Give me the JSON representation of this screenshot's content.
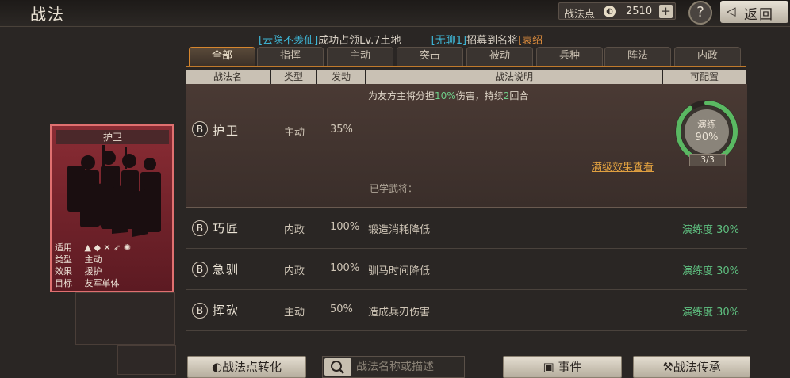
{
  "title": "战法",
  "points": {
    "label": "战法点",
    "value": "2510",
    "plus": "+"
  },
  "help": "?",
  "back": "返回",
  "ticker": {
    "p1": "[云隐不羡仙]",
    "p2": "成功占领Lv.7土地",
    "p3": "[无聊1]",
    "p4": "招募到名将",
    "p5": "[袁绍"
  },
  "tabs": [
    "全部",
    "指挥",
    "主动",
    "突击",
    "被动",
    "兵种",
    "阵法",
    "内政"
  ],
  "active_tab": "全部",
  "columns": [
    "战法名",
    "类型",
    "发动",
    "战法说明",
    "可配置"
  ],
  "card": {
    "name": "护卫",
    "applies_label": "适用",
    "type_label": "类型",
    "type_value": "主动",
    "effect_label": "效果",
    "effect_value": "援护",
    "target_label": "目标",
    "target_value": "友军单体"
  },
  "expanded": {
    "grade": "B",
    "name": "护卫",
    "type": "主动",
    "rate": "35%",
    "desc_1": "为友方主将分担",
    "desc_hl1": "10%",
    "desc_2": "伤害，持续",
    "desc_hl2": "2",
    "desc_3": "回合",
    "learned": "已学武将：  --",
    "gauge_label": "演练",
    "gauge_value": "90%",
    "gauge_fraction": 0.9,
    "gauge_count": "3/3",
    "details_link": "满级效果查看"
  },
  "rows": [
    {
      "grade": "B",
      "name": "巧匠",
      "type": "内政",
      "rate": "100%",
      "desc": "锻造消耗降低",
      "prof": "演练度 30%"
    },
    {
      "grade": "B",
      "name": "急驯",
      "type": "内政",
      "rate": "100%",
      "desc": "驯马时间降低",
      "prof": "演练度 30%"
    },
    {
      "grade": "B",
      "name": "挥砍",
      "type": "主动",
      "rate": "50%",
      "desc": "造成兵刃伤害",
      "prof": "演练度 30%"
    }
  ],
  "bottom": {
    "convert": "战法点转化",
    "search_placeholder": "战法名称或描述",
    "events": "事件",
    "inherit": "战法传承"
  },
  "colors": {
    "accent": "#d6862e",
    "green": "#5fc080",
    "cyan": "#3fb8d8"
  }
}
